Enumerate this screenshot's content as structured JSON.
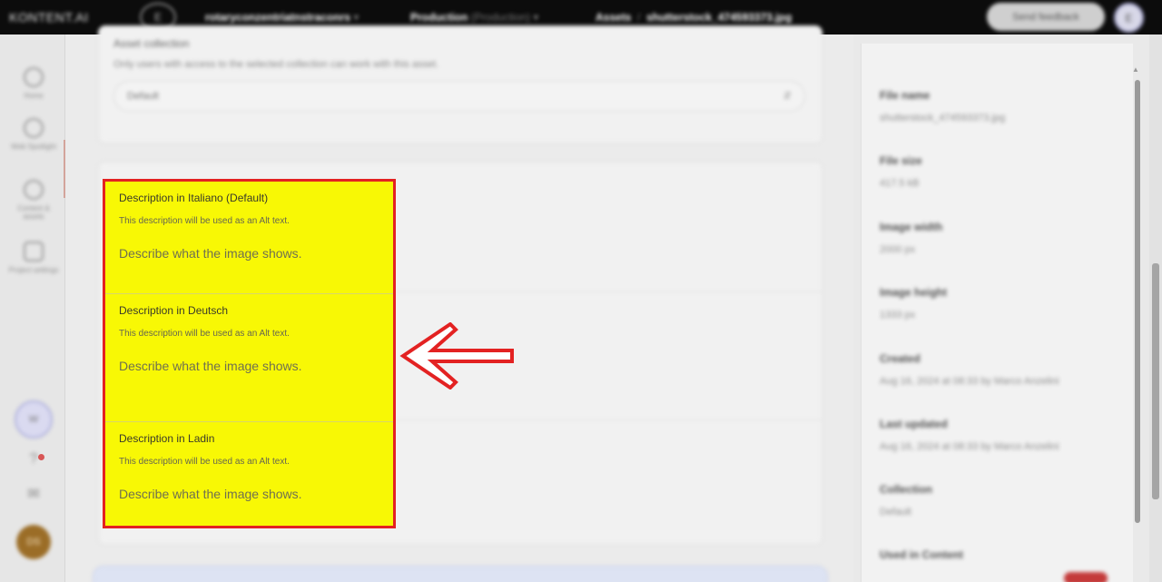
{
  "topbar": {
    "logo": "KONTENT.AI",
    "env_icon": "E",
    "project": "rotaryconzentriatnstraconrs",
    "environment_label": "Production",
    "environment_value": "(Production)",
    "section": "Assets",
    "asset_name": "shutterstock_474593373.jpg",
    "feedback_button": "Send feedback",
    "user_initial": "E"
  },
  "rail": {
    "items": [
      {
        "label": "Home",
        "icon": "home-icon"
      },
      {
        "label": "Web Spotlight",
        "icon": "spotlight-icon"
      },
      {
        "label": "Content & assets",
        "icon": "assets-icon"
      },
      {
        "label": "Project settings",
        "icon": "settings-icon"
      }
    ],
    "workspace_badge": "W",
    "help_symbol": "?",
    "avatar_initials": "DS"
  },
  "asset_collection": {
    "title": "Asset collection",
    "help": "Only users with access to the selected collection can work with this asset.",
    "selected": "Default"
  },
  "descriptions": [
    {
      "title": "Description in Italiano (Default)",
      "help": "This description will be used as an Alt text.",
      "placeholder": "Describe what the image shows."
    },
    {
      "title": "Description in Deutsch",
      "help": "This description will be used as an Alt text.",
      "placeholder": "Describe what the image shows."
    },
    {
      "title": "Description in Ladin",
      "help": "This description will be used as an Alt text.",
      "placeholder": "Describe what the image shows."
    }
  ],
  "metadata": [
    {
      "label": "File name",
      "value": "shutterstock_474593373.jpg"
    },
    {
      "label": "File size",
      "value": "417.5 kB"
    },
    {
      "label": "Image width",
      "value": "2000 px"
    },
    {
      "label": "Image height",
      "value": "1333 px"
    },
    {
      "label": "Created",
      "value": "Aug 16, 2024 at 08:33 by Marco Anzelini"
    },
    {
      "label": "Last updated",
      "value": "Aug 16, 2024 at 08:33 by Marco Anzelini"
    },
    {
      "label": "Collection",
      "value": "Default"
    },
    {
      "label": "Used in Content",
      "value": ""
    }
  ],
  "colors": {
    "highlight": "#f8f805",
    "highlight_border": "#e32222",
    "arrow": "#e32222"
  }
}
